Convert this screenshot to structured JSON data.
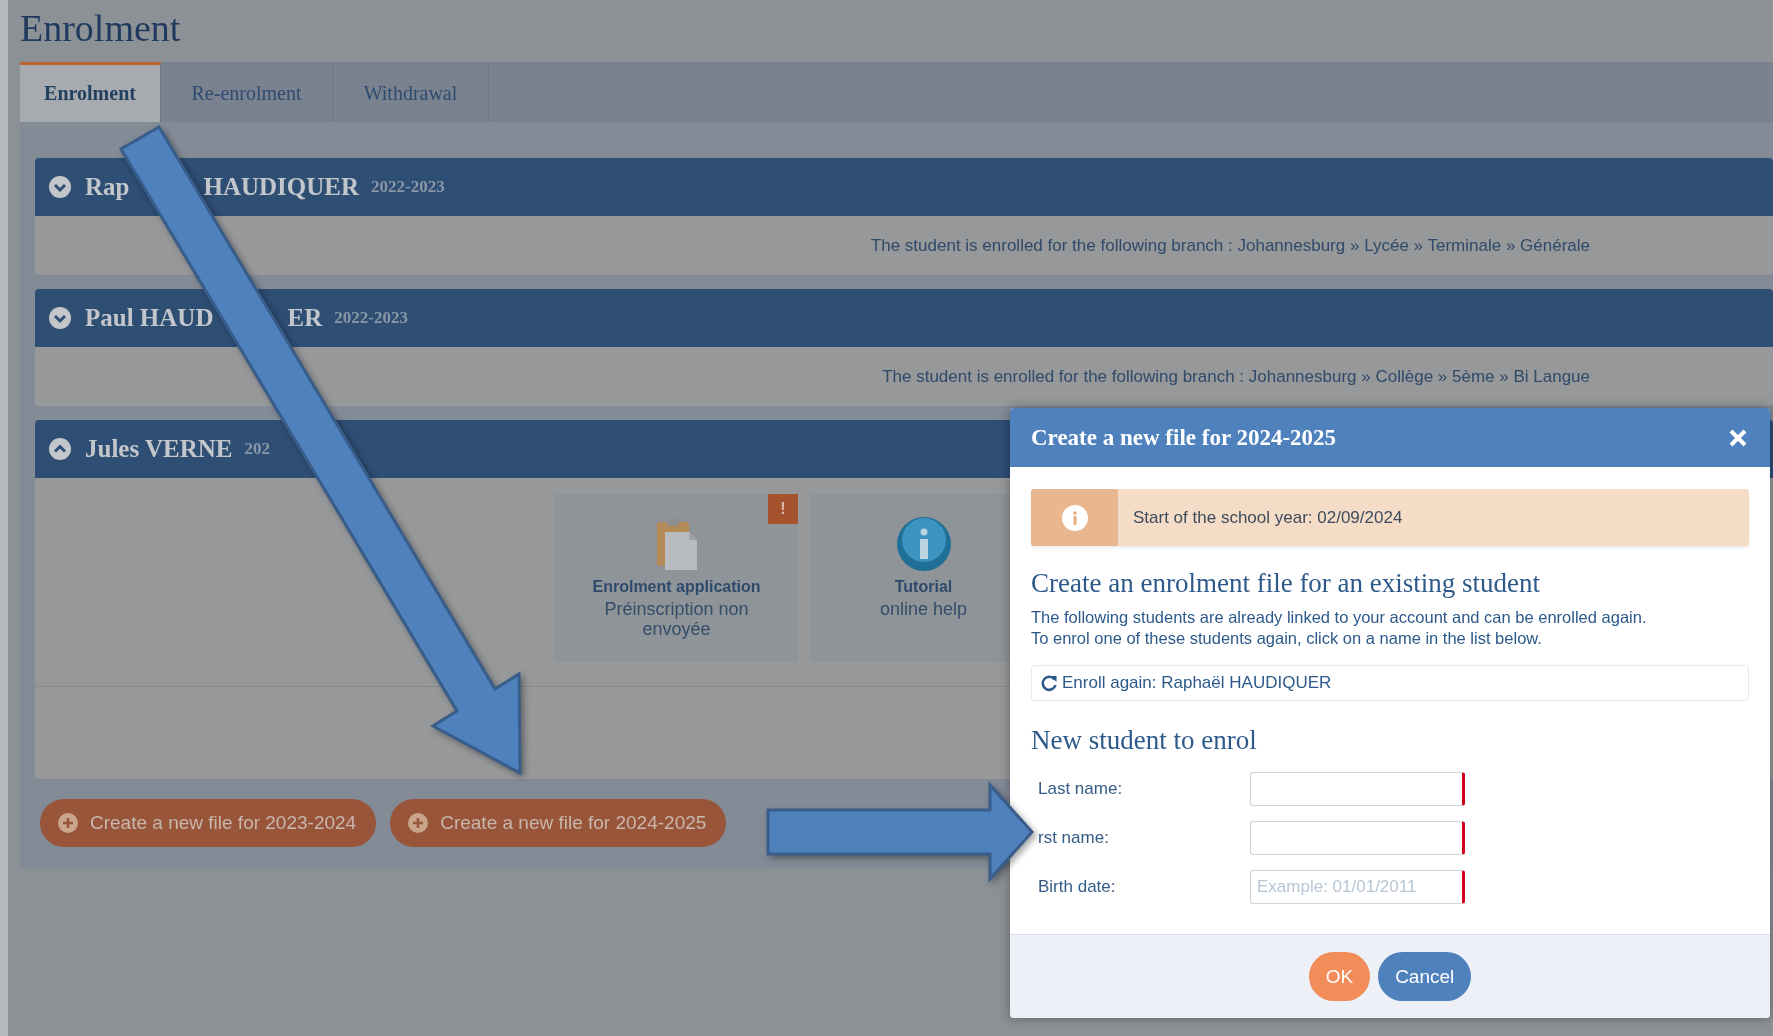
{
  "page_title": "Enrolment",
  "tabs": [
    {
      "label": "Enrolment",
      "selected": true
    },
    {
      "label": "Re-enrolment",
      "selected": false
    },
    {
      "label": "Withdrawal",
      "selected": false
    }
  ],
  "students": [
    {
      "name_parts": [
        "Rap",
        "HAUDIQUER"
      ],
      "year": "2022-2023",
      "expanded": false,
      "branch": "The student is enrolled for the following branch : Johannesburg » Lycée » Terminale » Générale"
    },
    {
      "name_parts": [
        "Paul HAUD",
        "ER"
      ],
      "year": "2022-2023",
      "expanded": false,
      "branch": "The student is enrolled for the following branch : Johannesburg » Collège » 5ème » Bi Langue"
    },
    {
      "name_parts": [
        "Jules VERNE"
      ],
      "year": "202",
      "expanded": true,
      "tiles": [
        {
          "kind": "application",
          "title": "Enrolment application",
          "subtitle": "Préinscription non envoyée",
          "alert": "!"
        },
        {
          "kind": "tutorial",
          "title": "Tutorial",
          "subtitle": "online help"
        }
      ]
    }
  ],
  "create_buttons": [
    "Create a new file for 2023-2024",
    "Create a new file for 2024-2025"
  ],
  "dialog": {
    "title": "Create a new file for 2024-2025",
    "notice": "Start of the school year: 02/09/2024",
    "existing_heading": "Create an enrolment file for an existing student",
    "existing_text": [
      "The following students are already linked to your account and can be enrolled again.",
      "To enrol one of these students again, click on a name in the list below."
    ],
    "reenrol_items": [
      "Enroll again: Raphaël HAUDIQUER"
    ],
    "new_heading": "New student to enrol",
    "fields": [
      {
        "label": "Last name:",
        "required": true
      },
      {
        "label": "rst name:",
        "required": true
      },
      {
        "label": "Birth date:",
        "placeholder": "Example: 01/01/2011",
        "required": true
      }
    ],
    "buttons": [
      {
        "label": "OK",
        "kind": "primary"
      },
      {
        "label": "Cancel",
        "kind": "secondary"
      }
    ]
  }
}
